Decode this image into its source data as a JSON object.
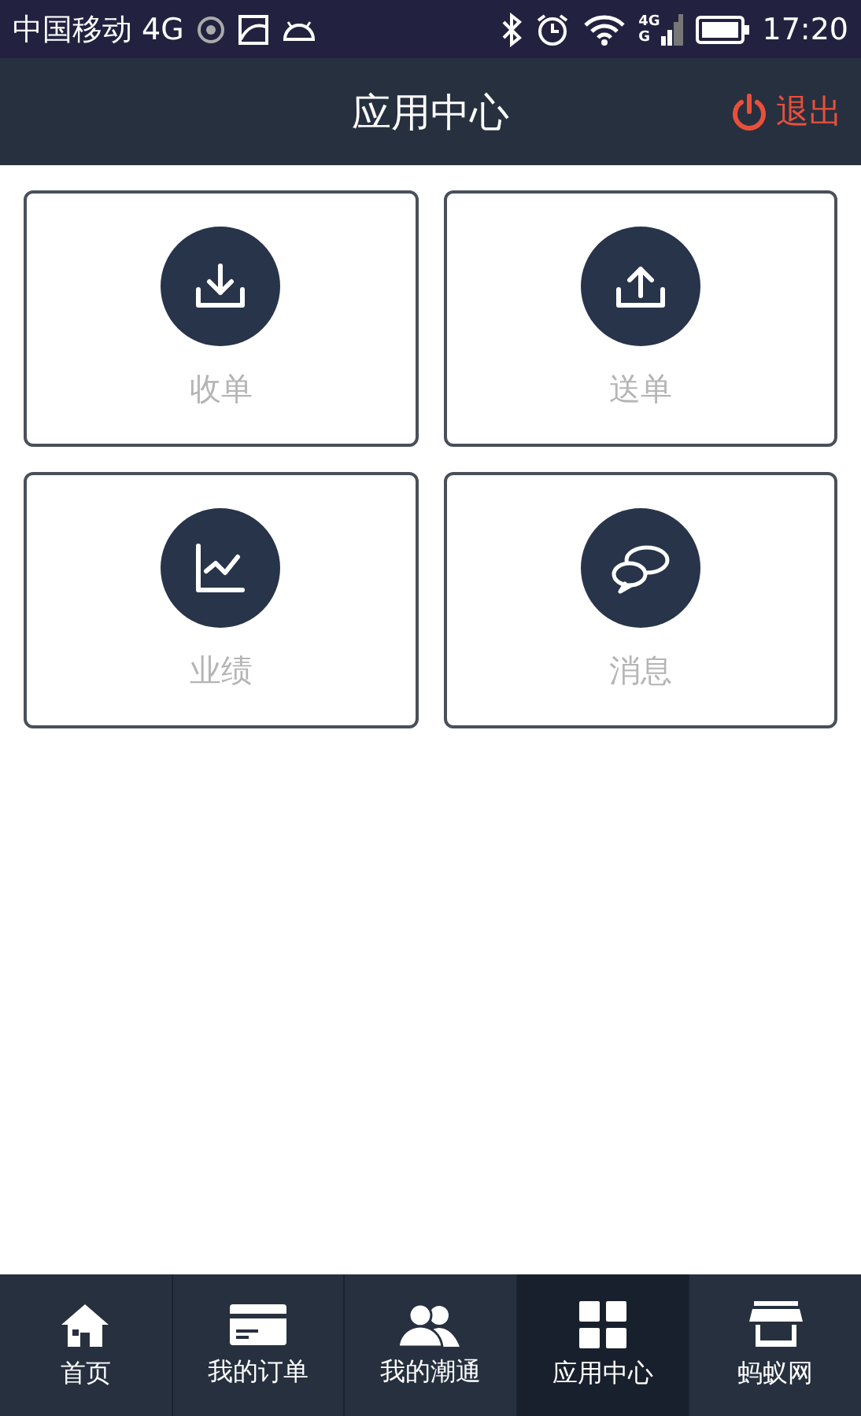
{
  "status_bar": {
    "carrier": "中国移动 4G",
    "signal_labels": [
      "4G",
      "G"
    ],
    "time": "17:20"
  },
  "header": {
    "title": "应用中心",
    "logout": "退出"
  },
  "apps": [
    {
      "label": "收单",
      "kind": "download"
    },
    {
      "label": "送单",
      "kind": "upload"
    },
    {
      "label": "业绩",
      "kind": "chart"
    },
    {
      "label": "消息",
      "kind": "chat"
    }
  ],
  "tabs": [
    {
      "label": "首页",
      "kind": "home",
      "selected": false
    },
    {
      "label": "我的订单",
      "kind": "card",
      "selected": false
    },
    {
      "label": "我的潮通",
      "kind": "people",
      "selected": false
    },
    {
      "label": "应用中心",
      "kind": "grid",
      "selected": true
    },
    {
      "label": "蚂蚁网",
      "kind": "store",
      "selected": false
    }
  ]
}
